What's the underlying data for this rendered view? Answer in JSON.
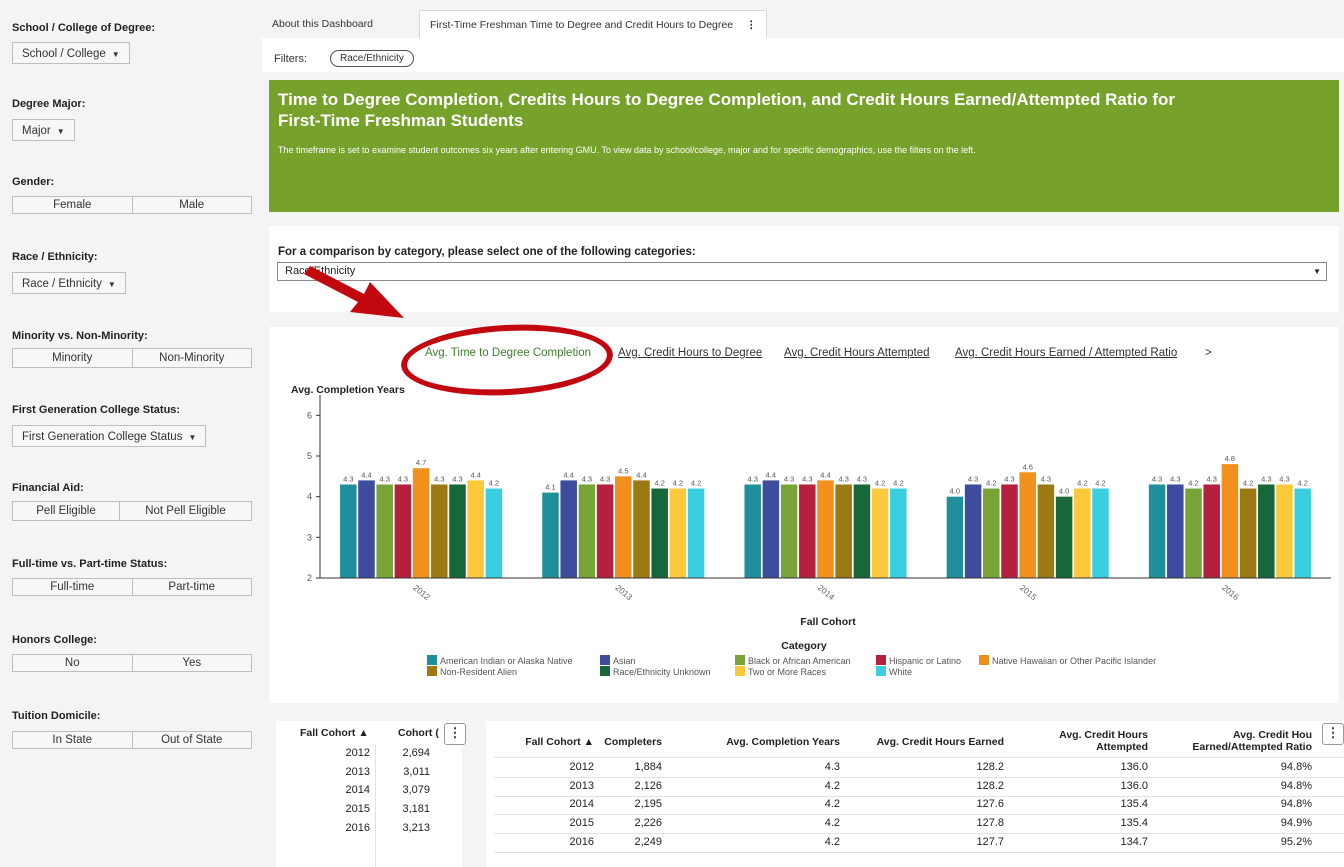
{
  "sidebar": {
    "school": {
      "label": "School / College of Degree:",
      "value": "School / College"
    },
    "major": {
      "label": "Degree Major:",
      "value": "Major"
    },
    "gender": {
      "label": "Gender:",
      "options": [
        "Female",
        "Male"
      ]
    },
    "race": {
      "label": "Race / Ethnicity:",
      "value": "Race / Ethnicity"
    },
    "minority": {
      "label": "Minority vs. Non-Minority:",
      "options": [
        "Minority",
        "Non-Minority"
      ]
    },
    "firstgen": {
      "label": "First Generation College Status:",
      "value": "First Generation College Status"
    },
    "aid": {
      "label": "Financial Aid:",
      "options": [
        "Pell Eligible",
        "Not Pell Eligible"
      ]
    },
    "fulltime": {
      "label": "Full-time vs. Part-time Status:",
      "options": [
        "Full-time",
        "Part-time"
      ]
    },
    "honors": {
      "label": "Honors College:",
      "options": [
        "No",
        "Yes"
      ]
    },
    "domicile": {
      "label": "Tuition Domicile:",
      "options": [
        "In State",
        "Out of State"
      ]
    }
  },
  "tabs": [
    "About this Dashboard",
    "First-Time Freshman Time to Degree and Credit Hours to Degree"
  ],
  "filters": {
    "label": "Filters:",
    "chip": "Race/Ethnicity"
  },
  "banner": {
    "title": "Time to Degree Completion, Credits Hours to Degree Completion, and Credit Hours Earned/Attempted Ratio for First-Time Freshman Students",
    "text": "The timeframe is set to examine student outcomes six years after entering GMU.  To view data by school/college, major and for specific demographics, use the filters on the left."
  },
  "category": {
    "question": "For a comparison by category, please select one of the following categories:",
    "selected": "Race/Ethnicity"
  },
  "chart_tabs": [
    "Avg. Time to Degree Completion",
    "Avg. Credit Hours to Degree",
    "Avg. Credit Hours Attempted",
    "Avg. Credit Hours Earned / Attempted Ratio"
  ],
  "chart_more": ">",
  "chart_data": {
    "type": "bar",
    "ylabel": "Avg. Completion Years",
    "xlabel": "Fall Cohort",
    "legend_title": "Category",
    "ylim": [
      2,
      6.5
    ],
    "yticks": [
      2,
      3,
      4,
      5,
      6
    ],
    "categories": [
      "2012",
      "2013",
      "2014",
      "2015",
      "2016"
    ],
    "series": [
      {
        "name": "American Indian or Alaska Native",
        "color": "#1f8f9b",
        "values": [
          4.3,
          4.1,
          4.3,
          4.0,
          4.3
        ]
      },
      {
        "name": "Asian",
        "color": "#3d4c9c",
        "values": [
          4.4,
          4.4,
          4.4,
          4.3,
          4.3
        ]
      },
      {
        "name": "Black or African American",
        "color": "#78a337",
        "values": [
          4.3,
          4.3,
          4.3,
          4.2,
          4.2
        ]
      },
      {
        "name": "Hispanic or Latino",
        "color": "#b4203e",
        "values": [
          4.3,
          4.3,
          4.3,
          4.3,
          4.3
        ]
      },
      {
        "name": "Native Hawaiian or Other Pacific Islander",
        "color": "#f1901d",
        "values": [
          4.7,
          4.5,
          4.4,
          4.6,
          4.8
        ]
      },
      {
        "name": "Non-Resident Alien",
        "color": "#9b7a14",
        "values": [
          4.3,
          4.4,
          4.3,
          4.3,
          4.2
        ]
      },
      {
        "name": "Race/Ethnicity Unknown",
        "color": "#17673a",
        "values": [
          4.3,
          4.2,
          4.3,
          4.0,
          4.3
        ]
      },
      {
        "name": "Two or More Races",
        "color": "#fbc93a",
        "values": [
          4.4,
          4.2,
          4.2,
          4.2,
          4.3
        ]
      },
      {
        "name": "White",
        "color": "#39cfe0",
        "values": [
          4.2,
          4.2,
          4.2,
          4.2,
          4.2
        ]
      }
    ]
  },
  "cohort_table": {
    "headers": [
      "Fall Cohort ▲",
      "Cohort ("
    ],
    "rows": [
      [
        "2012",
        "2,694"
      ],
      [
        "2013",
        "3,011"
      ],
      [
        "2014",
        "3,079"
      ],
      [
        "2015",
        "3,181"
      ],
      [
        "2016",
        "3,213"
      ]
    ]
  },
  "detail_table": {
    "headers": [
      "Fall Cohort ▲",
      "Completers",
      "Avg. Completion Years",
      "Avg. Credit Hours Earned",
      "Avg. Credit Hours Attempted",
      "Avg. Credit Hou Earned/Attempted Ratio"
    ],
    "rows": [
      [
        "2012",
        "1,884",
        "4.3",
        "128.2",
        "136.0",
        "94.8%"
      ],
      [
        "2013",
        "2,126",
        "4.2",
        "128.2",
        "136.0",
        "94.8%"
      ],
      [
        "2014",
        "2,195",
        "4.2",
        "127.6",
        "135.4",
        "94.8%"
      ],
      [
        "2015",
        "2,226",
        "4.2",
        "127.8",
        "135.4",
        "94.9%"
      ],
      [
        "2016",
        "2,249",
        "4.2",
        "127.7",
        "134.7",
        "95.2%"
      ]
    ]
  },
  "colors": {
    "banner": "#76a12b",
    "accent_tab": "#3f7f2f",
    "annotation_red": "#c3070f"
  },
  "icons": {
    "menu": "kebab-menu-icon",
    "dropdown": "caret-down-icon"
  }
}
